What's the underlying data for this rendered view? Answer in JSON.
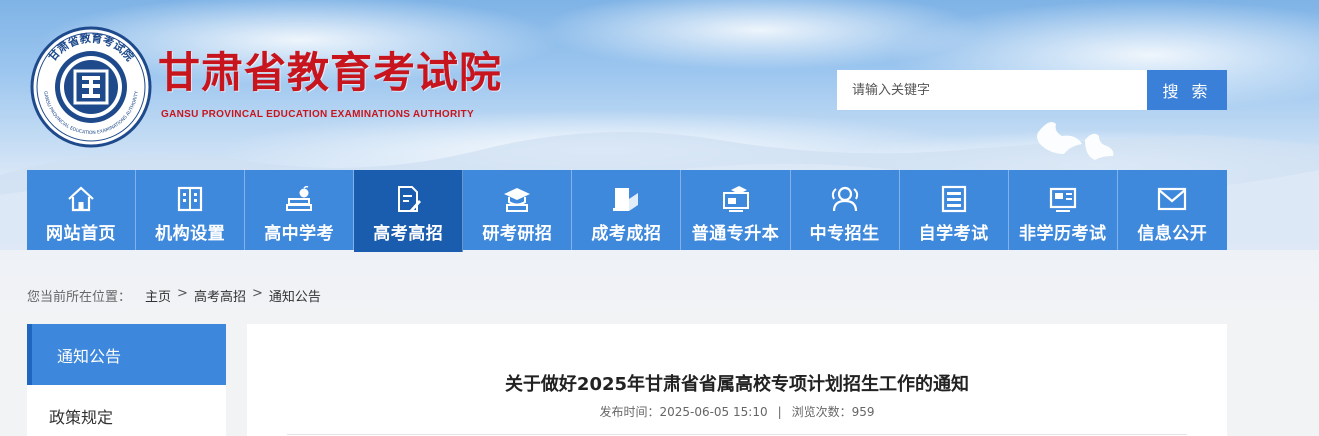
{
  "header": {
    "logo_title": "甘肃省教育考试院",
    "logo_subtitle": "GANSU PROVINCAL EDUCATION EXAMINATIONS AUTHORITY",
    "seal_text_top": "甘肃省教育考试院",
    "seal_text_ring": "GANSU PROVINCIAL EDUCATION EXAMINATIONS AUTHORITY",
    "brand_color": "#c8151d"
  },
  "search": {
    "placeholder": "请输入关键字",
    "button_label": "搜 索"
  },
  "nav": {
    "items": [
      {
        "label": "网站首页",
        "icon": "home-icon"
      },
      {
        "label": "机构设置",
        "icon": "building-icon"
      },
      {
        "label": "高中学考",
        "icon": "books-apple-icon"
      },
      {
        "label": "高考高招",
        "icon": "document-pen-icon"
      },
      {
        "label": "研考研招",
        "icon": "graduation-cap-icon"
      },
      {
        "label": "成考成招",
        "icon": "laptop-icon"
      },
      {
        "label": "普通专升本",
        "icon": "monitor-cap-icon"
      },
      {
        "label": "中专招生",
        "icon": "users-icon"
      },
      {
        "label": "自学考试",
        "icon": "list-document-icon"
      },
      {
        "label": "非学历考试",
        "icon": "id-card-icon"
      },
      {
        "label": "信息公开",
        "icon": "mail-icon"
      }
    ],
    "active_index": 3,
    "color": "#3d87dc",
    "active_color": "#1a5cae"
  },
  "breadcrumb": {
    "prefix": "您当前所在位置：",
    "items": [
      "主页",
      "高考高招",
      "通知公告"
    ],
    "separator": ">"
  },
  "sidebar": {
    "items": [
      "通知公告",
      "政策规定"
    ],
    "active_index": 0
  },
  "article": {
    "title": "关于做好2025年甘肃省省属高校专项计划招生工作的通知",
    "publish_label": "发布时间：",
    "publish_time": "2025-06-05 15:10",
    "meta_separator": "|",
    "views_label": "浏览次数：",
    "views": "959"
  }
}
